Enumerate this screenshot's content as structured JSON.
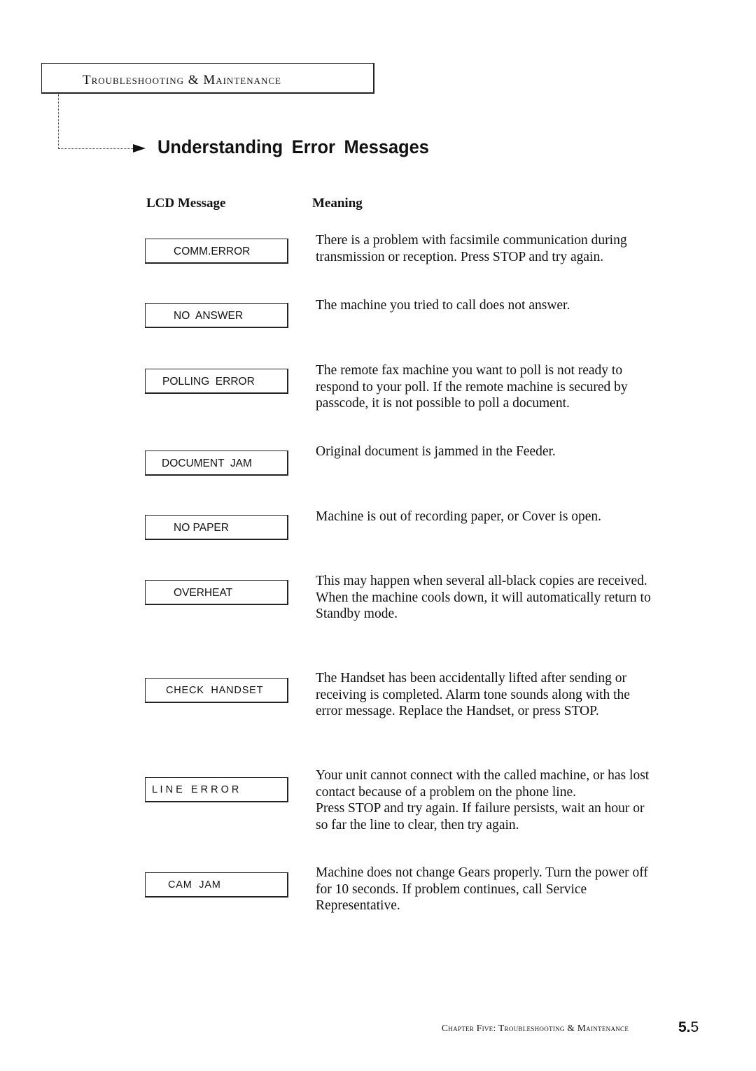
{
  "header": {
    "section_title": "Troubleshooting & Maintenance"
  },
  "page_title": "Understanding Error Messages",
  "columns": {
    "lcd_message": "LCD Message",
    "meaning": "Meaning"
  },
  "rows": [
    {
      "lcd": "COMM.ERROR",
      "meaning": "There is a problem with facsimile communication during\ntransmission or reception. Press STOP and try again."
    },
    {
      "lcd": "NO  ANSWER",
      "meaning": "The machine you tried to call does not answer."
    },
    {
      "lcd": "POLLING  ERROR",
      "meaning": "The remote fax machine you want to poll is not ready to\nrespond to your poll. If the remote machine is secured by\npasscode, it is not possible to poll a document."
    },
    {
      "lcd": "DOCUMENT  JAM",
      "meaning": "Original document is jammed in the Feeder."
    },
    {
      "lcd": "NO PAPER",
      "meaning": "Machine is out of recording paper, or Cover is open."
    },
    {
      "lcd": "OVERHEAT",
      "meaning": "This may happen when several all-black copies are received.\nWhen the machine cools down, it will automatically return to\nStandby  mode."
    },
    {
      "lcd": "CHECK  HANDSET",
      "meaning": "The Handset has been accidentally lifted after sending or\nreceiving is completed. Alarm tone sounds along with the\nerror message. Replace the Handset, or press STOP."
    },
    {
      "lcd": "L I N E   E R R O R",
      "meaning": "Your unit cannot connect with the called machine, or has lost\ncontact because of a problem on the phone line.\nPress STOP and try again. If failure persists, wait an hour or\nso far the line to clear, then try again."
    },
    {
      "lcd": "CAM  JAM",
      "meaning": "Machine does not change Gears properly. Turn the power off\nfor 10 seconds. If problem continues, call Service\nRepresentative."
    }
  ],
  "footer": {
    "chapter": "Chapter Five: Troubleshooting & Maintenance",
    "page_chapter": "5.",
    "page_number": "5"
  }
}
